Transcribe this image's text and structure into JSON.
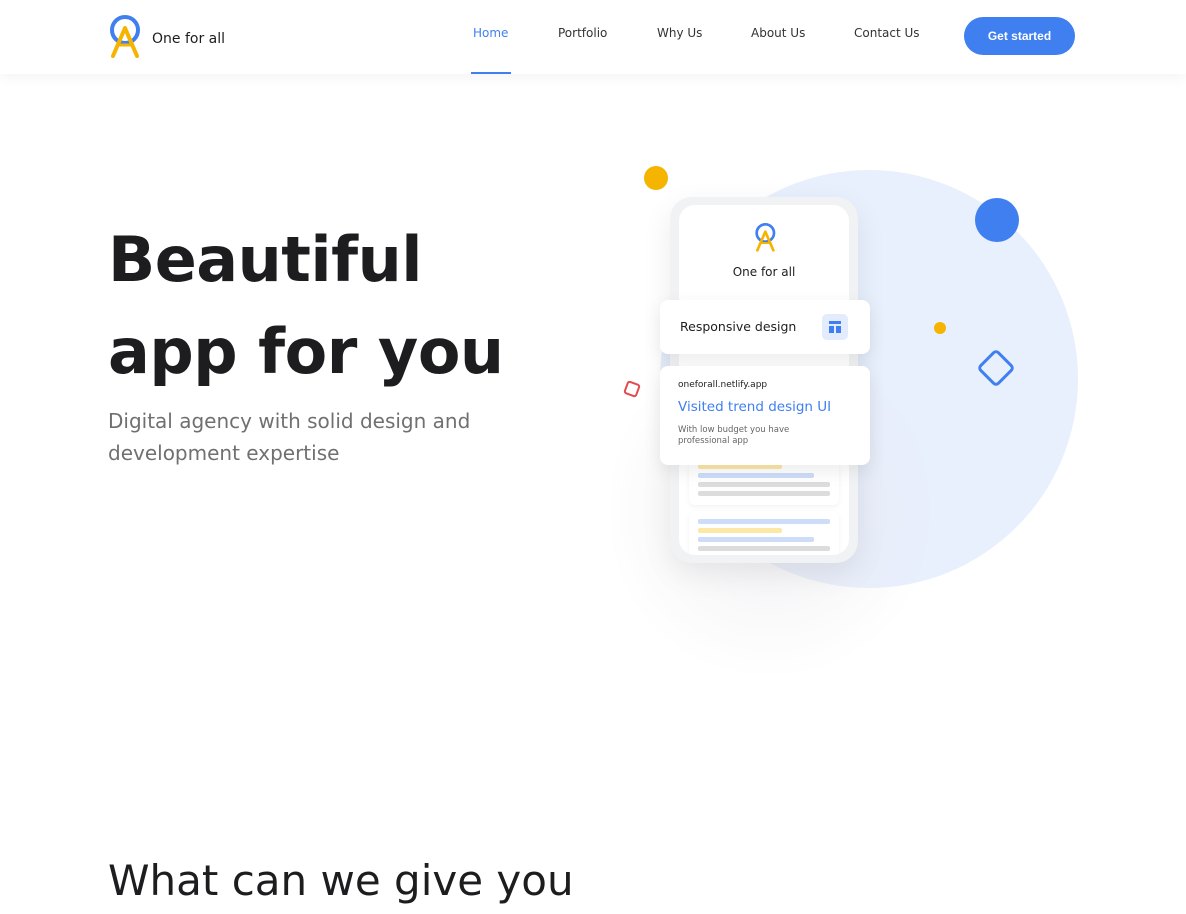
{
  "header": {
    "brand_name": "One for all",
    "nav": [
      {
        "label": "Home",
        "active": true
      },
      {
        "label": "Portfolio",
        "active": false
      },
      {
        "label": "Why Us",
        "active": false
      },
      {
        "label": "About Us",
        "active": false
      },
      {
        "label": "Contact Us",
        "active": false
      }
    ],
    "cta_label": "Get started"
  },
  "hero": {
    "title_line1": "Beautiful",
    "title_line2": "app for you",
    "subtitle": "Digital agency with solid design and development expertise"
  },
  "illustration": {
    "phone_brand": "One for all",
    "card_feature_label": "Responsive design",
    "card_url": "oneforall.netlify.app",
    "card_title": "Visited trend design UI",
    "card_text": "With low budget you have professional app"
  },
  "section": {
    "title": "What can we give you"
  },
  "colors": {
    "accent": "#3f7ff0",
    "yellow": "#f5b400",
    "red": "#e5484d",
    "light_blue": "#e8effd"
  },
  "icons": {
    "logo": "one-for-all-logo",
    "feature": "layout-icon"
  }
}
